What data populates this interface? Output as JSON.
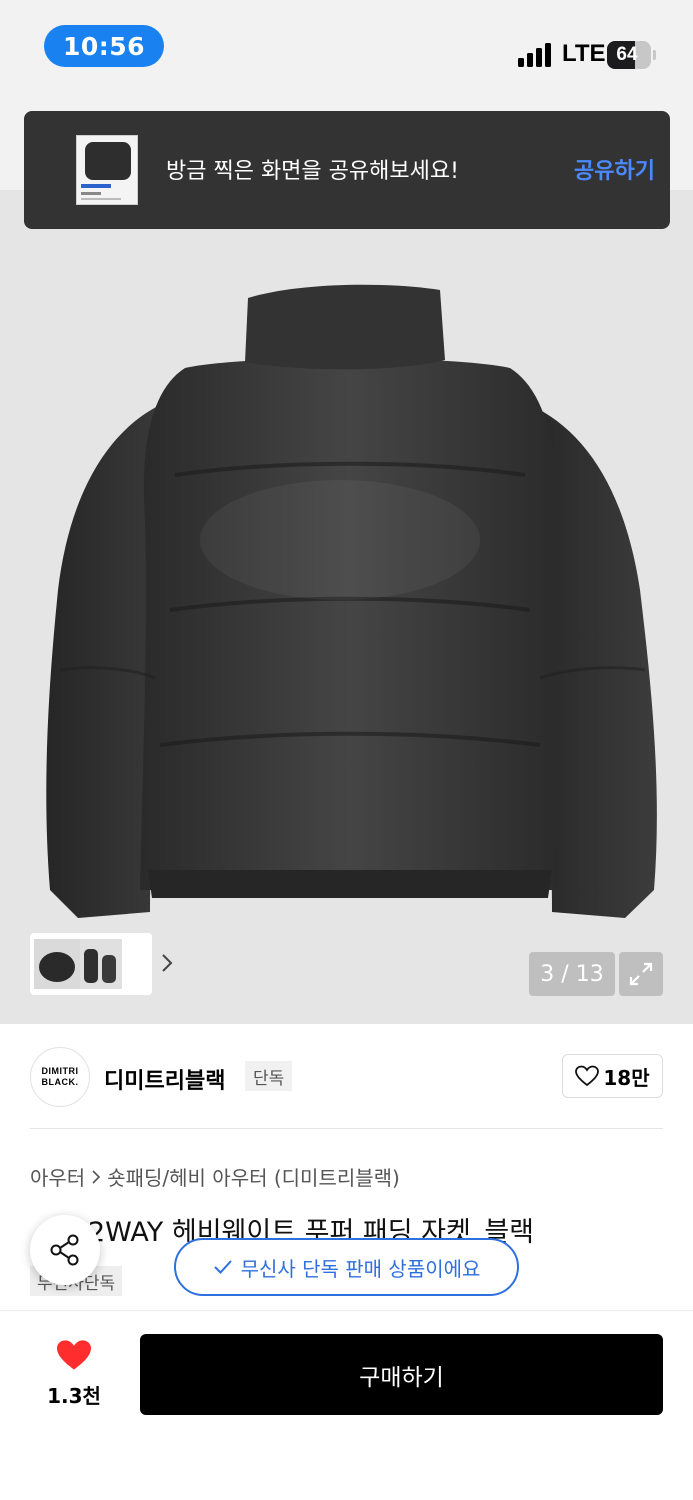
{
  "status_bar": {
    "time": "10:56",
    "network": "LTE",
    "battery": "64",
    "battery_level": 0.64
  },
  "toast": {
    "message": "방금 찍은 화면을 공유해보세요!",
    "action_label": "공유하기"
  },
  "gallery": {
    "counter": "3 / 13",
    "expand_icon": "expand-icon"
  },
  "brand": {
    "logo_line1": "DIMITRI",
    "logo_line2": "BLACK.",
    "name": "디미트리블랙",
    "badge": "단독",
    "likes": "18만"
  },
  "breadcrumb": {
    "level1": "아우터",
    "level2": "숏패딩/헤비 아우터 (디미트리블랙)"
  },
  "product": {
    "title": "2WAY 헤비웨이트 푸퍼 패딩 자켓_블랙",
    "tag": "무신사단독",
    "exclusive_notice": "무신사 단독 판매 상품이에요"
  },
  "bottom_bar": {
    "like_count": "1.3천",
    "buy_label": "구매하기"
  },
  "colors": {
    "accent_blue": "#2f6fe0",
    "time_pill": "#1a82f0",
    "heart_red": "#ff2d2d",
    "buy_button": "#000000"
  }
}
